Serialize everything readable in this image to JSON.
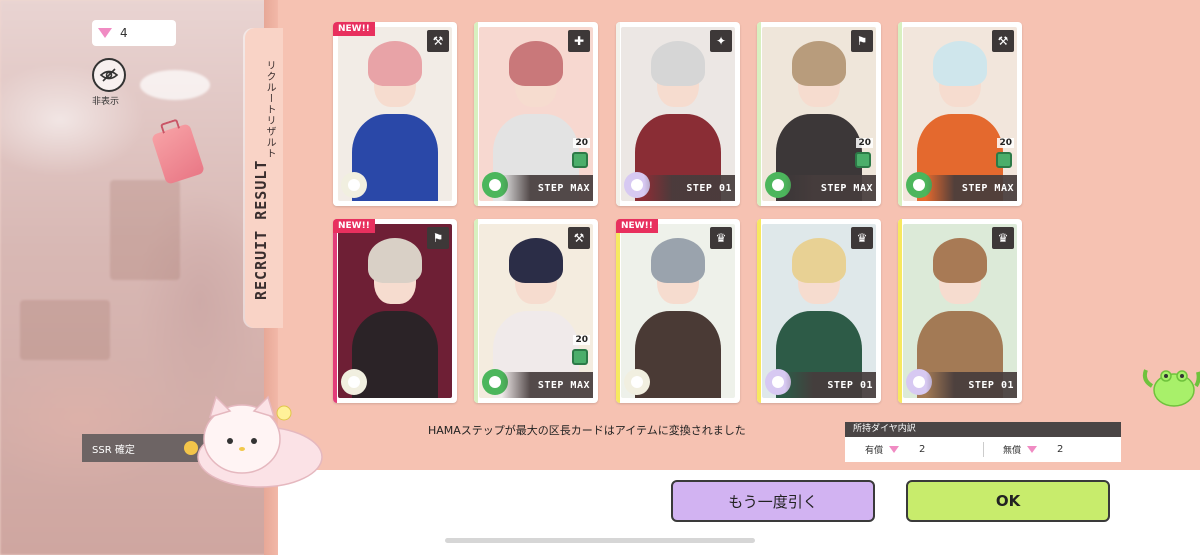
{
  "currency": {
    "gems": "4"
  },
  "hide": {
    "label": "非表示"
  },
  "title": {
    "en": "RECRUIT RESULT",
    "jp": "リクルートリザルト"
  },
  "ssr": {
    "label": "SSR 確定"
  },
  "cards": [
    {
      "new": true,
      "new_label": "NEW!!",
      "icon": "drill-icon",
      "icon_glyph": "⚒",
      "step": "",
      "count": "",
      "stripe": "#ffffff",
      "hair": "#e8a3a7",
      "body": "#2a48a8",
      "bg": "#f2ece6",
      "swirl": "#f1efe0"
    },
    {
      "new": false,
      "new_label": "",
      "icon": "firstaid-icon",
      "icon_glyph": "✚",
      "step": "STEP MAX",
      "count": "20",
      "stripe": "#d8f0c0",
      "hair": "#c9787a",
      "body": "#e3e3e3",
      "bg": "#f7d8d0",
      "swirl": "#4cb65c"
    },
    {
      "new": false,
      "new_label": "",
      "icon": "star-hand-icon",
      "icon_glyph": "✦",
      "step": "STEP 01",
      "count": "",
      "stripe": "#f3f1ea",
      "hair": "#d6d6d6",
      "body": "#8a2d35",
      "bg": "#ece7e4",
      "swirl": "#d7c9f2"
    },
    {
      "new": false,
      "new_label": "",
      "icon": "flag-icon",
      "icon_glyph": "⚑",
      "step": "STEP MAX",
      "count": "20",
      "stripe": "#d8f0c0",
      "hair": "#b89c7c",
      "body": "#3c3738",
      "bg": "#efe6da",
      "swirl": "#4cb65c"
    },
    {
      "new": false,
      "new_label": "",
      "icon": "drill-icon",
      "icon_glyph": "⚒",
      "step": "STEP MAX",
      "count": "20",
      "stripe": "#d8f0c0",
      "hair": "#cfe6ec",
      "body": "#e4692e",
      "bg": "#f2e6dc",
      "swirl": "#4cb65c"
    },
    {
      "new": true,
      "new_label": "NEW!!",
      "icon": "flag-icon",
      "icon_glyph": "⚑",
      "step": "",
      "count": "",
      "stripe": "#e23d7a",
      "hair": "#d9d0c6",
      "body": "#2b2327",
      "bg": "#6e1f35",
      "swirl": "#f1efe0"
    },
    {
      "new": false,
      "new_label": "",
      "icon": "drill-icon",
      "icon_glyph": "⚒",
      "step": "STEP MAX",
      "count": "20",
      "stripe": "#d8f0c0",
      "hair": "#2b2d47",
      "body": "#f0eaea",
      "bg": "#f4ecdf",
      "swirl": "#4cb65c"
    },
    {
      "new": true,
      "new_label": "NEW!!",
      "icon": "jester-icon",
      "icon_glyph": "♛",
      "step": "",
      "count": "",
      "stripe": "#f7e860",
      "hair": "#9aa3ad",
      "body": "#4a3a35",
      "bg": "#eef1ea",
      "swirl": "#f1efe0"
    },
    {
      "new": false,
      "new_label": "",
      "icon": "jester-icon",
      "icon_glyph": "♛",
      "step": "STEP 01",
      "count": "",
      "stripe": "#f7e860",
      "hair": "#e8d194",
      "body": "#2d5b47",
      "bg": "#dfe8ea",
      "swirl": "#d7c9f2"
    },
    {
      "new": false,
      "new_label": "",
      "icon": "jester-icon",
      "icon_glyph": "♛",
      "step": "STEP 01",
      "count": "",
      "stripe": "#f7e860",
      "hair": "#a87a55",
      "body": "#a37a55",
      "bg": "#dcead8",
      "swirl": "#d7c9f2"
    }
  ],
  "notice": "HAMAステップが最大の区長カードはアイテムに変換されました",
  "diamond": {
    "header": "所持ダイヤ内訳",
    "paid_label": "有償",
    "paid_value": "2",
    "free_label": "無償",
    "free_value": "2"
  },
  "buttons": {
    "again": "もう一度引く",
    "ok": "OK"
  }
}
